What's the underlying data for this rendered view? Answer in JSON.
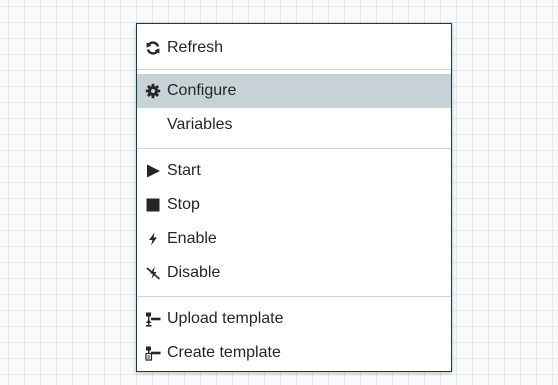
{
  "context_menu": {
    "items": [
      {
        "label": "Refresh",
        "icon": "refresh-icon"
      },
      {
        "label": "Configure",
        "icon": "gear-icon",
        "highlighted": true
      },
      {
        "label": "Variables",
        "icon": ""
      },
      {
        "label": "Start",
        "icon": "play-icon"
      },
      {
        "label": "Stop",
        "icon": "stop-icon"
      },
      {
        "label": "Enable",
        "icon": "bolt-icon"
      },
      {
        "label": "Disable",
        "icon": "disable-bolt-icon"
      },
      {
        "label": "Upload template",
        "icon": "upload-template-icon"
      },
      {
        "label": "Create template",
        "icon": "create-template-icon"
      }
    ]
  },
  "colors": {
    "menu_border": "#004849",
    "highlight_bg": "#c7d2d7",
    "text": "#262626",
    "icon": "#262626"
  }
}
